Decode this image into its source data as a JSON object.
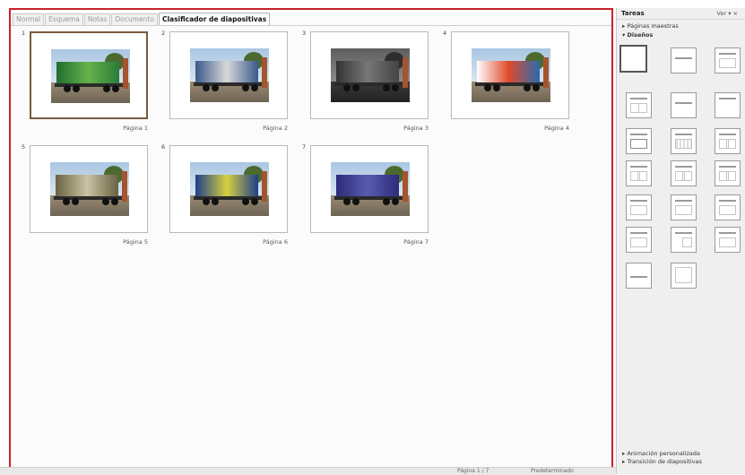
{
  "tabs": [
    "Normal",
    "Esquema",
    "Notas",
    "Documento",
    "Clasificador de diapositivas"
  ],
  "active_tab": "Clasificador de diapositivas",
  "slides": [
    {
      "num": "1",
      "caption": "Página 1",
      "selected": true
    },
    {
      "num": "2",
      "caption": "Página 2",
      "selected": false
    },
    {
      "num": "3",
      "caption": "Página 3",
      "selected": false
    },
    {
      "num": "4",
      "caption": "Página 4",
      "selected": false
    },
    {
      "num": "5",
      "caption": "Página 5",
      "selected": false
    },
    {
      "num": "6",
      "caption": "Página 6",
      "selected": false
    },
    {
      "num": "7",
      "caption": "Página 7",
      "selected": false
    }
  ],
  "sidebar": {
    "title": "Tareas",
    "view_label": "Ver",
    "sections": {
      "master_pages": "Páginas maestras",
      "layouts": "Diseños",
      "custom_animation": "Animación personalizada",
      "slide_transition": "Transición de diapositivas"
    }
  },
  "status": {
    "slide": "Página 1 / 7",
    "layout": "Predeterminado"
  },
  "colors": {
    "frame_border": "#c8222a",
    "selected_border": "#7a5a3a"
  }
}
